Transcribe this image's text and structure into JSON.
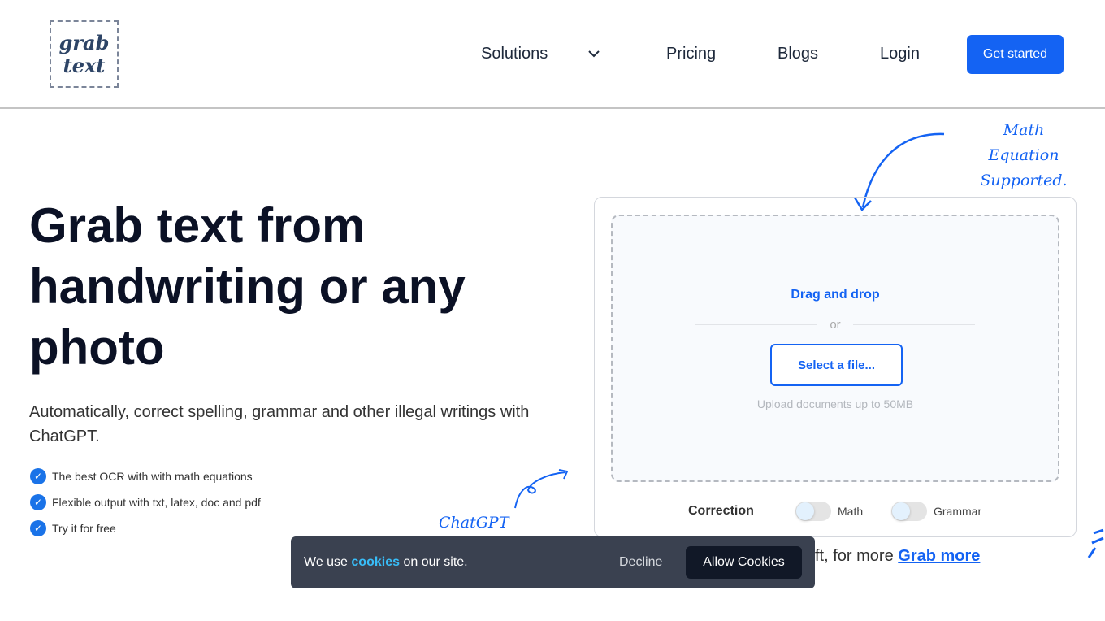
{
  "header": {
    "logo_line1": "grab",
    "logo_line2": "text",
    "nav": {
      "solutions": "Solutions",
      "pricing": "Pricing",
      "blogs": "Blogs",
      "login": "Login"
    },
    "cta": "Get started"
  },
  "hero": {
    "title": "Grab text from handwriting or any photo",
    "subtitle": "Automatically, correct spelling, grammar and other illegal writings with ChatGPT.",
    "features": [
      "The best OCR with with math equations",
      "Flexible output with txt, latex, doc and pdf",
      "Try it for free"
    ]
  },
  "annotations": {
    "math_line1": "Math Equation",
    "math_line2": "Supported.",
    "chatgpt": "ChatGPT"
  },
  "upload": {
    "drag": "Drag and drop",
    "or": "or",
    "select": "Select a file...",
    "limit": "Upload documents up to 50MB"
  },
  "correction": {
    "label": "Correction",
    "options": [
      {
        "label": "Math",
        "on": false
      },
      {
        "label": "Grammar",
        "on": false
      }
    ]
  },
  "more": {
    "text": "ft, for more",
    "link": "Grab more"
  },
  "cookie": {
    "pre": "We use",
    "link": "cookies",
    "post": "on our site.",
    "decline": "Decline",
    "allow": "Allow Cookies"
  },
  "colors": {
    "accent": "#1463f3",
    "banner": "#3a4150"
  }
}
